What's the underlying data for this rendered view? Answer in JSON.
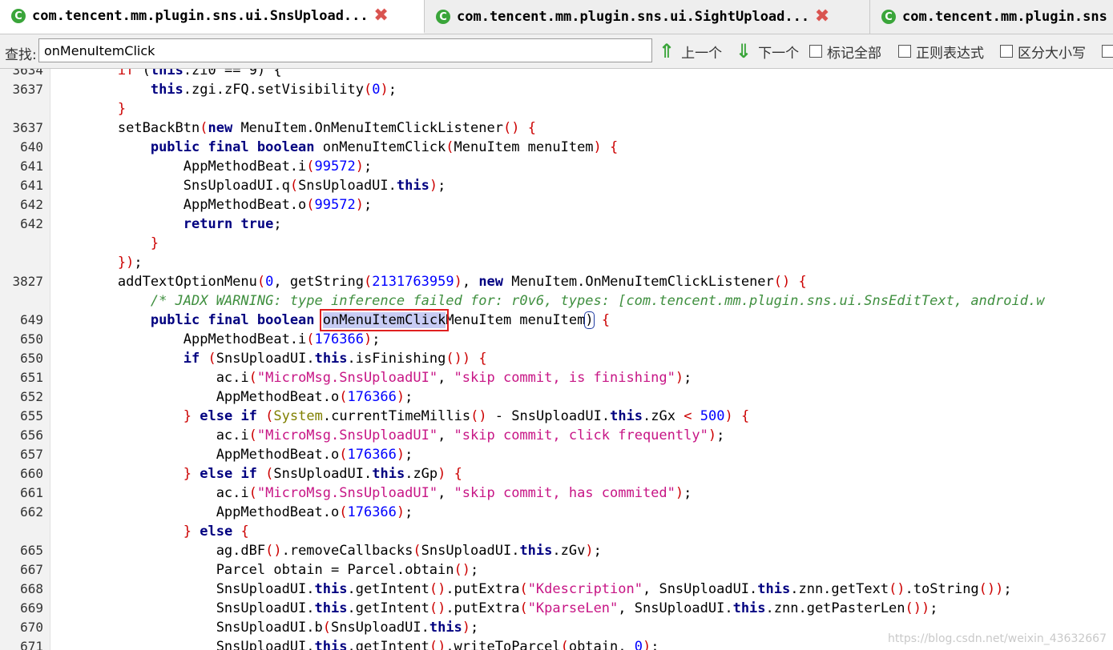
{
  "tabs": [
    {
      "label": "com.tencent.mm.plugin.sns.ui.SnsUpload...",
      "active": true,
      "icon": "class-icon"
    },
    {
      "label": "com.tencent.mm.plugin.sns.ui.SightUpload...",
      "active": false,
      "icon": "class-icon"
    },
    {
      "label": "com.tencent.mm.plugin.sns",
      "active": false,
      "icon": "class-icon"
    }
  ],
  "tab_icon_letter": "C",
  "search": {
    "label": "查找:",
    "value": "onMenuItemClick",
    "prev_label": "上一个",
    "next_label": "下一个",
    "mark_all_label": "标记全部",
    "regex_label": "正则表达式",
    "case_label": "区分大小写"
  },
  "colors": {
    "keyword": "#000080",
    "number": "#0000ff",
    "string": "#c71585",
    "comment": "#3f8f3f",
    "paren": "#cc0000",
    "highlight": "#c8ccf4",
    "highlight_border": "#e02020",
    "arrow": "#3aa53a"
  },
  "code_lines": [
    {
      "ln": "3634",
      "tokens": [
        [
          "        ",
          ""
        ],
        [
          "if",
          "pn"
        ],
        [
          " (",
          ""
        ],
        [
          "this",
          "kw"
        ],
        [
          ".zi0 == 9) {",
          ""
        ]
      ]
    },
    {
      "ln": "3637",
      "tokens": [
        [
          "            ",
          ""
        ],
        [
          "this",
          "kw"
        ],
        [
          ".zgi.zFQ.setVisibility",
          ""
        ],
        [
          "(",
          "pn"
        ],
        [
          "0",
          "num"
        ],
        [
          ")",
          "pn"
        ],
        [
          ";",
          ""
        ]
      ]
    },
    {
      "ln": "",
      "tokens": [
        [
          "        ",
          ""
        ],
        [
          "}",
          "pn"
        ]
      ]
    },
    {
      "ln": "3637",
      "tokens": [
        [
          "        setBackBtn",
          ""
        ],
        [
          "(",
          "pn"
        ],
        [
          "new",
          "kw"
        ],
        [
          " MenuItem.OnMenuItemClickListener",
          ""
        ],
        [
          "()",
          "pn"
        ],
        [
          " ",
          ""
        ],
        [
          "{",
          "pn"
        ]
      ]
    },
    {
      "ln": "640",
      "tokens": [
        [
          "            ",
          ""
        ],
        [
          "public final boolean",
          "kw"
        ],
        [
          " onMenuItemClick",
          ""
        ],
        [
          "(",
          "pn"
        ],
        [
          "MenuItem menuItem",
          ""
        ],
        [
          ")",
          "pn"
        ],
        [
          " ",
          ""
        ],
        [
          "{",
          "pn"
        ]
      ]
    },
    {
      "ln": "641",
      "tokens": [
        [
          "                AppMethodBeat.i",
          ""
        ],
        [
          "(",
          "pn"
        ],
        [
          "99572",
          "num"
        ],
        [
          ")",
          "pn"
        ],
        [
          ";",
          ""
        ]
      ]
    },
    {
      "ln": "641",
      "tokens": [
        [
          "                SnsUploadUI.q",
          ""
        ],
        [
          "(",
          "pn"
        ],
        [
          "SnsUploadUI.",
          ""
        ],
        [
          "this",
          "kw"
        ],
        [
          ")",
          "pn"
        ],
        [
          ";",
          ""
        ]
      ]
    },
    {
      "ln": "642",
      "tokens": [
        [
          "                AppMethodBeat.o",
          ""
        ],
        [
          "(",
          "pn"
        ],
        [
          "99572",
          "num"
        ],
        [
          ")",
          "pn"
        ],
        [
          ";",
          ""
        ]
      ]
    },
    {
      "ln": "642",
      "tokens": [
        [
          "                ",
          ""
        ],
        [
          "return true",
          "kw"
        ],
        [
          ";",
          ""
        ]
      ]
    },
    {
      "ln": "",
      "tokens": [
        [
          "            ",
          ""
        ],
        [
          "}",
          "pn"
        ]
      ]
    },
    {
      "ln": "",
      "tokens": [
        [
          "        ",
          ""
        ],
        [
          "})",
          "pn"
        ],
        [
          ";",
          ""
        ]
      ]
    },
    {
      "ln": "3827",
      "tokens": [
        [
          "        addTextOptionMenu",
          ""
        ],
        [
          "(",
          "pn"
        ],
        [
          "0",
          "num"
        ],
        [
          ", getString",
          ""
        ],
        [
          "(",
          "pn"
        ],
        [
          "2131763959",
          "num"
        ],
        [
          ")",
          "pn"
        ],
        [
          ", ",
          ""
        ],
        [
          "new",
          "kw"
        ],
        [
          " MenuItem.OnMenuItemClickListener",
          ""
        ],
        [
          "()",
          "pn"
        ],
        [
          " ",
          ""
        ],
        [
          "{",
          "pn"
        ]
      ]
    },
    {
      "ln": "",
      "tokens": [
        [
          "            ",
          ""
        ],
        [
          "/* JADX WARNING: type inference failed for: r0v6, types: [com.tencent.mm.plugin.sns.ui.SnsEditText, android.w",
          "cmt"
        ]
      ]
    },
    {
      "ln": "649",
      "tokens": [
        [
          "            ",
          ""
        ],
        [
          "public final boolean",
          "kw"
        ],
        [
          " ",
          ""
        ],
        [
          "onMenuItemClick",
          "hlbox"
        ],
        [
          "MenuItem menuItem",
          ""
        ],
        [
          ")",
          "bracemark"
        ],
        [
          " ",
          ""
        ],
        [
          "{",
          "pn"
        ]
      ]
    },
    {
      "ln": "650",
      "tokens": [
        [
          "                AppMethodBeat.i",
          ""
        ],
        [
          "(",
          "pn"
        ],
        [
          "176366",
          "num"
        ],
        [
          ")",
          "pn"
        ],
        [
          ";",
          ""
        ]
      ]
    },
    {
      "ln": "650",
      "tokens": [
        [
          "                ",
          ""
        ],
        [
          "if",
          "kw"
        ],
        [
          " ",
          ""
        ],
        [
          "(",
          "pn"
        ],
        [
          "SnsUploadUI.",
          ""
        ],
        [
          "this",
          "kw"
        ],
        [
          ".isFinishing",
          ""
        ],
        [
          "())",
          "pn"
        ],
        [
          " ",
          ""
        ],
        [
          "{",
          "pn"
        ]
      ]
    },
    {
      "ln": "651",
      "tokens": [
        [
          "                    ac.i",
          ""
        ],
        [
          "(",
          "pn"
        ],
        [
          "\"MicroMsg.SnsUploadUI\"",
          "str"
        ],
        [
          ", ",
          ""
        ],
        [
          "\"skip commit, is finishing\"",
          "str"
        ],
        [
          ")",
          "pn"
        ],
        [
          ";",
          ""
        ]
      ]
    },
    {
      "ln": "652",
      "tokens": [
        [
          "                    AppMethodBeat.o",
          ""
        ],
        [
          "(",
          "pn"
        ],
        [
          "176366",
          "num"
        ],
        [
          ")",
          "pn"
        ],
        [
          ";",
          ""
        ]
      ]
    },
    {
      "ln": "655",
      "tokens": [
        [
          "                ",
          ""
        ],
        [
          "}",
          "pn"
        ],
        [
          " ",
          ""
        ],
        [
          "else if",
          "kw"
        ],
        [
          " ",
          ""
        ],
        [
          "(",
          "pn"
        ],
        [
          "System",
          "cls"
        ],
        [
          ".currentTimeMillis",
          ""
        ],
        [
          "()",
          "pn"
        ],
        [
          " - SnsUploadUI.",
          ""
        ],
        [
          "this",
          "kw"
        ],
        [
          ".zGx ",
          ""
        ],
        [
          "<",
          "pn"
        ],
        [
          " ",
          ""
        ],
        [
          "500",
          "num"
        ],
        [
          ")",
          "pn"
        ],
        [
          " ",
          ""
        ],
        [
          "{",
          "pn"
        ]
      ]
    },
    {
      "ln": "656",
      "tokens": [
        [
          "                    ac.i",
          ""
        ],
        [
          "(",
          "pn"
        ],
        [
          "\"MicroMsg.SnsUploadUI\"",
          "str"
        ],
        [
          ", ",
          ""
        ],
        [
          "\"skip commit, click frequently\"",
          "str"
        ],
        [
          ")",
          "pn"
        ],
        [
          ";",
          ""
        ]
      ]
    },
    {
      "ln": "657",
      "tokens": [
        [
          "                    AppMethodBeat.o",
          ""
        ],
        [
          "(",
          "pn"
        ],
        [
          "176366",
          "num"
        ],
        [
          ")",
          "pn"
        ],
        [
          ";",
          ""
        ]
      ]
    },
    {
      "ln": "660",
      "tokens": [
        [
          "                ",
          ""
        ],
        [
          "}",
          "pn"
        ],
        [
          " ",
          ""
        ],
        [
          "else if",
          "kw"
        ],
        [
          " ",
          ""
        ],
        [
          "(",
          "pn"
        ],
        [
          "SnsUploadUI.",
          ""
        ],
        [
          "this",
          "kw"
        ],
        [
          ".zGp",
          ""
        ],
        [
          ")",
          "pn"
        ],
        [
          " ",
          ""
        ],
        [
          "{",
          "pn"
        ]
      ]
    },
    {
      "ln": "661",
      "tokens": [
        [
          "                    ac.i",
          ""
        ],
        [
          "(",
          "pn"
        ],
        [
          "\"MicroMsg.SnsUploadUI\"",
          "str"
        ],
        [
          ", ",
          ""
        ],
        [
          "\"skip commit, has commited\"",
          "str"
        ],
        [
          ")",
          "pn"
        ],
        [
          ";",
          ""
        ]
      ]
    },
    {
      "ln": "662",
      "tokens": [
        [
          "                    AppMethodBeat.o",
          ""
        ],
        [
          "(",
          "pn"
        ],
        [
          "176366",
          "num"
        ],
        [
          ")",
          "pn"
        ],
        [
          ";",
          ""
        ]
      ]
    },
    {
      "ln": "",
      "tokens": [
        [
          "                ",
          ""
        ],
        [
          "}",
          "pn"
        ],
        [
          " ",
          ""
        ],
        [
          "else",
          "kw"
        ],
        [
          " ",
          ""
        ],
        [
          "{",
          "pn"
        ]
      ]
    },
    {
      "ln": "665",
      "tokens": [
        [
          "                    ag.dBF",
          ""
        ],
        [
          "()",
          "pn"
        ],
        [
          ".removeCallbacks",
          ""
        ],
        [
          "(",
          "pn"
        ],
        [
          "SnsUploadUI.",
          ""
        ],
        [
          "this",
          "kw"
        ],
        [
          ".zGv",
          ""
        ],
        [
          ")",
          "pn"
        ],
        [
          ";",
          ""
        ]
      ]
    },
    {
      "ln": "667",
      "tokens": [
        [
          "                    Parcel obtain = Parcel.obtain",
          ""
        ],
        [
          "()",
          "pn"
        ],
        [
          ";",
          ""
        ]
      ]
    },
    {
      "ln": "668",
      "tokens": [
        [
          "                    SnsUploadUI.",
          ""
        ],
        [
          "this",
          "kw"
        ],
        [
          ".getIntent",
          ""
        ],
        [
          "()",
          "pn"
        ],
        [
          ".putExtra",
          ""
        ],
        [
          "(",
          "pn"
        ],
        [
          "\"Kdescription\"",
          "str"
        ],
        [
          ", SnsUploadUI.",
          ""
        ],
        [
          "this",
          "kw"
        ],
        [
          ".znn.getText",
          ""
        ],
        [
          "()",
          "pn"
        ],
        [
          ".toString",
          ""
        ],
        [
          "())",
          "pn"
        ],
        [
          ";",
          ""
        ]
      ]
    },
    {
      "ln": "669",
      "tokens": [
        [
          "                    SnsUploadUI.",
          ""
        ],
        [
          "this",
          "kw"
        ],
        [
          ".getIntent",
          ""
        ],
        [
          "()",
          "pn"
        ],
        [
          ".putExtra",
          ""
        ],
        [
          "(",
          "pn"
        ],
        [
          "\"KparseLen\"",
          "str"
        ],
        [
          ", SnsUploadUI.",
          ""
        ],
        [
          "this",
          "kw"
        ],
        [
          ".znn.getPasterLen",
          ""
        ],
        [
          "())",
          "pn"
        ],
        [
          ";",
          ""
        ]
      ]
    },
    {
      "ln": "670",
      "tokens": [
        [
          "                    SnsUploadUI.b",
          ""
        ],
        [
          "(",
          "pn"
        ],
        [
          "SnsUploadUI.",
          ""
        ],
        [
          "this",
          "kw"
        ],
        [
          ")",
          "pn"
        ],
        [
          ";",
          ""
        ]
      ]
    },
    {
      "ln": "671",
      "tokens": [
        [
          "                    SnsUploadUI.",
          ""
        ],
        [
          "this",
          "kw"
        ],
        [
          ".getIntent",
          ""
        ],
        [
          "()",
          "pn"
        ],
        [
          ".writeToParcel",
          ""
        ],
        [
          "(",
          "pn"
        ],
        [
          "obtain, ",
          ""
        ],
        [
          "0",
          "num"
        ],
        [
          ")",
          "pn"
        ],
        [
          ";",
          ""
        ]
      ]
    }
  ],
  "watermark": "https://blog.csdn.net/weixin_43632667"
}
